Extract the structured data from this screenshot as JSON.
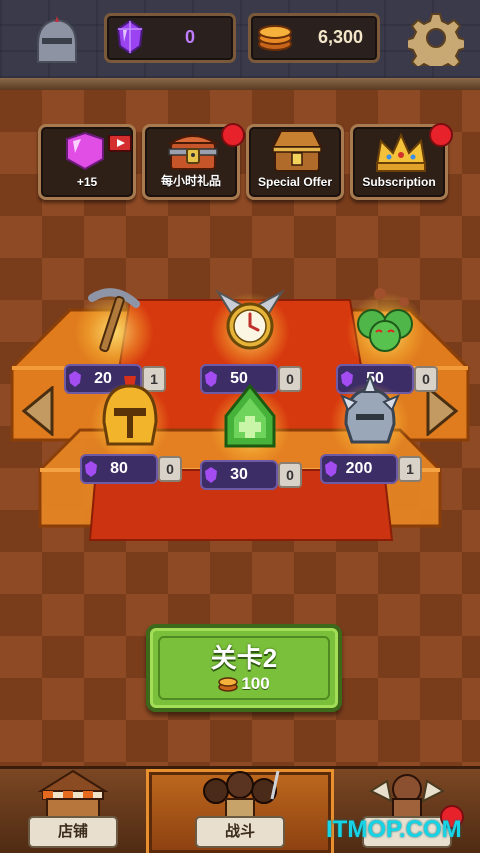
{
  "header": {
    "gems": "0",
    "coins": "6,300",
    "icons": [
      "gem-icon",
      "coin-icon",
      "gear-icon",
      "helmet-decor-icon"
    ]
  },
  "shop_tiles": [
    {
      "id": "gems-video",
      "label": "+15",
      "icon": "gem-video-icon",
      "badge": false
    },
    {
      "id": "hourly-gift",
      "label": "每小时礼品",
      "icon": "treasure-chest-icon",
      "badge": true
    },
    {
      "id": "special-offer",
      "label": "Special Offer",
      "icon": "open-chest-icon",
      "badge": false
    },
    {
      "id": "subscription",
      "label": "Subscription",
      "icon": "crown-icon",
      "badge": true
    }
  ],
  "items": [
    {
      "name": "pickaxe",
      "price": "20",
      "count": "1",
      "icon": "pickaxe-icon"
    },
    {
      "name": "stopwatch",
      "price": "50",
      "count": "0",
      "icon": "stopwatch-icon"
    },
    {
      "name": "poison-bombs",
      "price": "50",
      "count": "0",
      "icon": "poison-bomb-icon"
    },
    {
      "name": "golden-helmet",
      "price": "80",
      "count": "0",
      "icon": "golden-helmet-icon"
    },
    {
      "name": "heal-potion",
      "price": "30",
      "count": "0",
      "icon": "heal-potion-icon"
    },
    {
      "name": "spiked-helmet",
      "price": "200",
      "count": "1",
      "icon": "spiked-helmet-icon"
    }
  ],
  "level_button": {
    "title": "关卡2",
    "cost": "100"
  },
  "bottom_nav": [
    {
      "id": "shop",
      "label": "店铺",
      "active": false
    },
    {
      "id": "battle",
      "label": "战斗",
      "active": true
    },
    {
      "id": "heroes",
      "label": "",
      "active": false,
      "badge": true
    }
  ],
  "watermark": "ITMOP.COM",
  "colors": {
    "gem": "#b05cff",
    "level_button": "#7bc03a",
    "badge": "#e8222a"
  }
}
